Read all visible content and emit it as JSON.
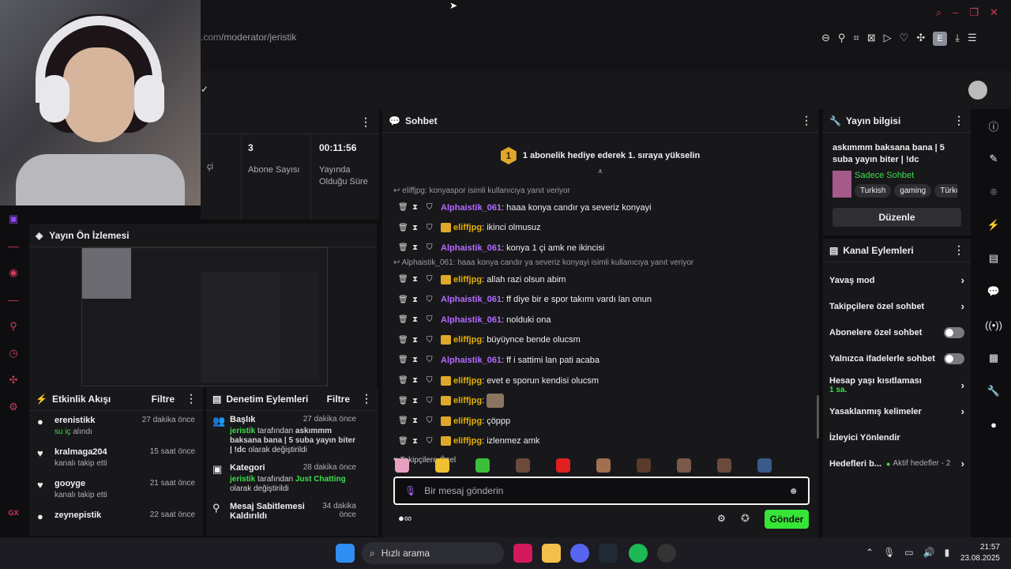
{
  "browser": {
    "url_prefix": ".com",
    "url_path": "/moderator/jeristik",
    "avatar_letter": "E"
  },
  "stats": {
    "partial_label": "çi",
    "subs_value": "3",
    "subs_label": "Abone Sayısı",
    "uptime_value": "00:11:56",
    "uptime_label": "Yayında Olduğu Süre"
  },
  "preview": {
    "title": "Yayın Ön İzlemesi"
  },
  "activity": {
    "title": "Etkinlik Akışı",
    "filter": "Filtre",
    "items": [
      {
        "name": "erenistikk",
        "desc": "su iç alındı",
        "desc_highlight": "su iç",
        "desc_rest": "alındı",
        "time": "27 dakika önce"
      },
      {
        "name": "kralmaga204",
        "desc": "kanalı takip etti",
        "time": "15 saat önce"
      },
      {
        "name": "gooyge",
        "desc": "kanalı takip etti",
        "time": "21 saat önce"
      },
      {
        "name": "zeynepistik",
        "desc": "",
        "time": "22 saat önce"
      }
    ]
  },
  "moderation": {
    "title": "Denetim Eylemleri",
    "filter": "Filtre",
    "items": [
      {
        "title": "Başlık",
        "time": "27 dakika önce",
        "actor": "jeristik",
        "text_mid": "tarafından",
        "content": "askımmm baksana bana | 5 suba yayın biter | !dc",
        "text_end": "olarak değiştirildi"
      },
      {
        "title": "Kategori",
        "time": "28 dakika önce",
        "actor": "jeristik",
        "text_mid": "tarafından",
        "content": "Just Chatting",
        "text_end": "olarak değiştirildi"
      },
      {
        "title": "Mesaj Sabitlemesi Kaldırıldı",
        "time": "34 dakika önce"
      }
    ]
  },
  "chat": {
    "title": "Sohbet",
    "banner_num": "1",
    "banner": "1 abonelik hediye ederek 1. sıraya yükselin",
    "reply1": "eliffjpg: konyaspor isimli kullanıcıya yanıt veriyor",
    "reply2": "Alphaistik_061: haaa konya candır ya severiz konyayi isimli kullanıcıya yanıt veriyor",
    "messages": [
      {
        "user": "Alphaistik_061",
        "text": "haaa konya candır ya severiz konyayi",
        "type": "u1"
      },
      {
        "user": "eliffjpg",
        "text": "ikinci olmusuz",
        "type": "u2"
      },
      {
        "user": "Alphaistik_061",
        "text": "konya 1 çi amk ne ikincisi",
        "type": "u1"
      },
      {
        "user": "eliffjpg",
        "text": "allah razi olsun abim",
        "type": "u2"
      },
      {
        "user": "Alphaistik_061",
        "text": "ff diye bir e spor takımı vardı lan onun",
        "type": "u1"
      },
      {
        "user": "Alphaistik_061",
        "text": "nolduki ona",
        "type": "u1"
      },
      {
        "user": "eliffjpg",
        "text": "büyüynce bende olucsm",
        "type": "u2"
      },
      {
        "user": "Alphaistik_061",
        "text": "ff i sattimi lan pati acaba",
        "type": "u1"
      },
      {
        "user": "eliffjpg",
        "text": "evet e sporun kendisi olucsm",
        "type": "u2"
      },
      {
        "user": "eliffjpg",
        "text": "",
        "type": "u2"
      },
      {
        "user": "eliffjpg",
        "text": "çöppp",
        "type": "u2"
      },
      {
        "user": "eliffjpg",
        "text": "izlenmez amk",
        "type": "u2"
      }
    ],
    "followers_only": "Takipçilere Özel",
    "placeholder": "Bir mesaj gönderin",
    "send": "Gönder"
  },
  "info": {
    "title": "Yayın bilgisi",
    "stream_title": "askımmm baksana bana | 5 suba yayın biter | !dc",
    "category": "Sadece Sohbet",
    "tags": [
      "Turkish",
      "gaming",
      "Türkçe"
    ],
    "edit": "Düzenle"
  },
  "channel": {
    "title": "Kanal Eylemleri",
    "slow": "Yavaş mod",
    "followers": "Takipçilere özel sohbet",
    "subs": "Abonelere özel sohbet",
    "emotes": "Yalnızca ifadelerle sohbet",
    "account_age": "Hesap yaşı kısıtlaması",
    "account_age_val": "1 sa.",
    "banned": "Yasaklanmış kelimeler",
    "redirect": "İzleyici Yönlendir",
    "goals": "Hedefleri b...",
    "goals_status": "Aktif hedefler - 2"
  },
  "taskbar": {
    "search": "Hızlı arama",
    "time": "21:57",
    "date": "23.08.2025"
  },
  "colors": {
    "accent": "#37e537",
    "purple": "#b36bff",
    "gold": "#e3b000"
  }
}
